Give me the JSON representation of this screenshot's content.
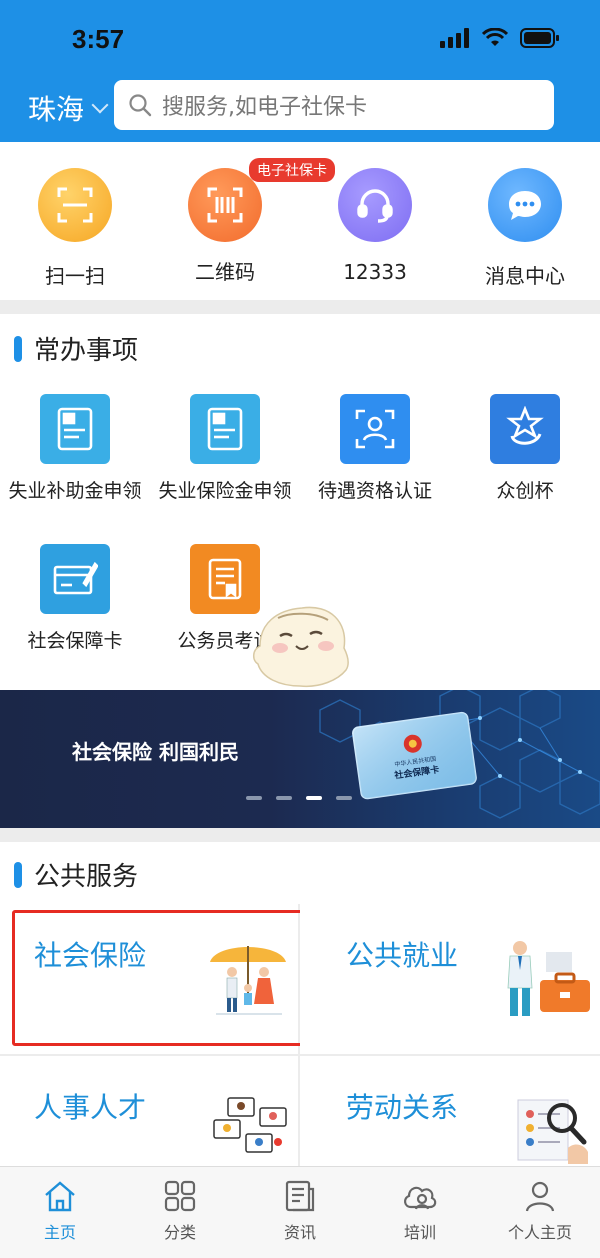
{
  "status": {
    "time": "3:57"
  },
  "header": {
    "city": "珠海",
    "search_placeholder": "搜服务,如电子社保卡"
  },
  "quick_actions": [
    {
      "label": "扫一扫",
      "icon": "scan-icon",
      "color": "#f6a623"
    },
    {
      "label": "二维码",
      "icon": "qrcode-icon",
      "color": "#f26b2c",
      "badge": "电子社保卡"
    },
    {
      "label": "12333",
      "icon": "headset-icon",
      "color": "#7e6df2"
    },
    {
      "label": "消息中心",
      "icon": "message-icon",
      "color": "#2f8ef0"
    }
  ],
  "common": {
    "title": "常办事项",
    "items": [
      {
        "label": "失业补助金申领",
        "icon": "document-icon",
        "color": "#3aaee6"
      },
      {
        "label": "失业保险金申领",
        "icon": "document-icon",
        "color": "#3aaee6"
      },
      {
        "label": "待遇资格认证",
        "icon": "face-scan-icon",
        "color": "#2f8ef0"
      },
      {
        "label": "众创杯",
        "icon": "trophy-logo-icon",
        "color": "#2f7ee0"
      },
      {
        "label": "社会保障卡",
        "icon": "card-icon",
        "color": "#2fa0e0"
      },
      {
        "label": "公务员考试",
        "icon": "exam-icon",
        "color": "#f28a22"
      }
    ]
  },
  "banner": {
    "text": "社会保险 利国利民",
    "card_text": "社会保障卡",
    "card_small": "中华人民共和国",
    "slide_index": 3,
    "slide_count": 4
  },
  "public": {
    "title": "公共服务",
    "cards": [
      {
        "label": "社会保险",
        "icon": "umbrella-family-icon"
      },
      {
        "label": "公共就业",
        "icon": "employment-icon"
      },
      {
        "label": "人事人才",
        "icon": "talent-icon"
      },
      {
        "label": "劳动关系",
        "icon": "labor-relations-icon"
      }
    ]
  },
  "tabbar": {
    "active": "主页",
    "items": [
      {
        "label": "主页",
        "icon": "home-icon"
      },
      {
        "label": "分类",
        "icon": "grid-icon"
      },
      {
        "label": "资讯",
        "icon": "news-icon"
      },
      {
        "label": "培训",
        "icon": "training-icon"
      },
      {
        "label": "个人主页",
        "icon": "user-icon"
      }
    ]
  },
  "colors": {
    "primary": "#1e90e6",
    "highlight_border": "#e62b22",
    "card_title": "#1e8fd8"
  }
}
